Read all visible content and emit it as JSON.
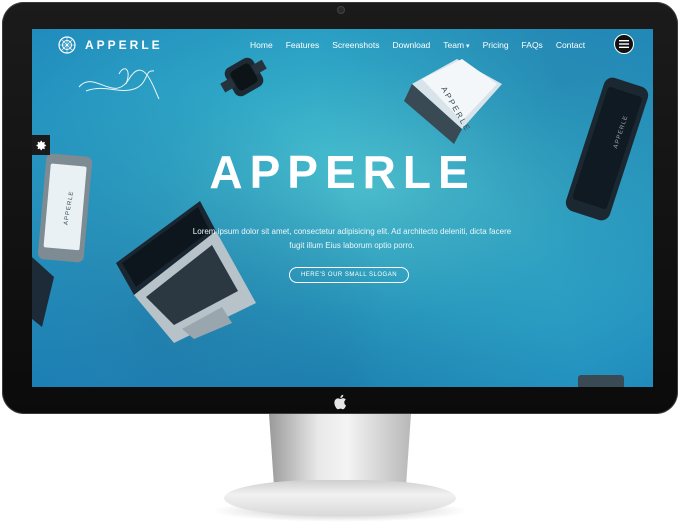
{
  "brand": {
    "name": "APPERLE"
  },
  "nav": {
    "links": [
      {
        "label": "Home"
      },
      {
        "label": "Features"
      },
      {
        "label": "Screenshots"
      },
      {
        "label": "Download"
      },
      {
        "label": "Team",
        "dropdown": true
      },
      {
        "label": "Pricing"
      },
      {
        "label": "FAQs"
      },
      {
        "label": "Contact"
      }
    ],
    "menu_icon": "hamburger-icon"
  },
  "hero": {
    "title": "APPERLE",
    "description": "Lorem ipsum dolor sit amet, consectetur adipisicing elit. Ad architecto deleniti, dicta facere fugit illum Eius laborum optio porro.",
    "button_label": "Here's our small slogan"
  },
  "devices": {
    "phone_label": "APPERLE",
    "box_label": "APPERLE",
    "right_phone_label": "APPERLE"
  },
  "settings": {
    "icon": "gear-icon"
  },
  "colors": {
    "screen_center": "#4ec3cf",
    "screen_edge": "#1d86bb",
    "bezel": "#0b0b0b",
    "stand": "#e9e9e9"
  }
}
